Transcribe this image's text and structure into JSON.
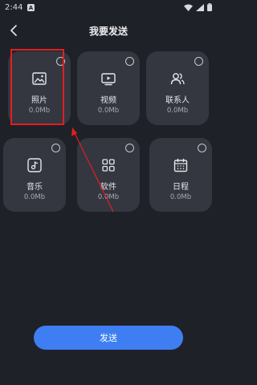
{
  "status": {
    "time": "2:44",
    "notification_icon": "a-badge-icon",
    "icons": [
      "wifi-icon",
      "signal-icon",
      "battery-icon"
    ]
  },
  "header": {
    "title": "我要发送",
    "back_icon": "chevron-left-icon"
  },
  "categories": [
    {
      "label": "照片",
      "size": "0.0Mb",
      "icon": "image-icon"
    },
    {
      "label": "视频",
      "size": "0.0Mb",
      "icon": "video-icon"
    },
    {
      "label": "联系人",
      "size": "0.0Mb",
      "icon": "contacts-icon"
    },
    {
      "label": "音乐",
      "size": "0.0Mb",
      "icon": "music-icon"
    },
    {
      "label": "软件",
      "size": "0.0Mb",
      "icon": "apps-icon"
    },
    {
      "label": "日程",
      "size": "0.0Mb",
      "icon": "calendar-icon"
    }
  ],
  "send_button": {
    "label": "发送"
  },
  "colors": {
    "background": "#1f2128",
    "card": "#343640",
    "accent": "#3f7ef2",
    "annotation": "#e02020"
  }
}
